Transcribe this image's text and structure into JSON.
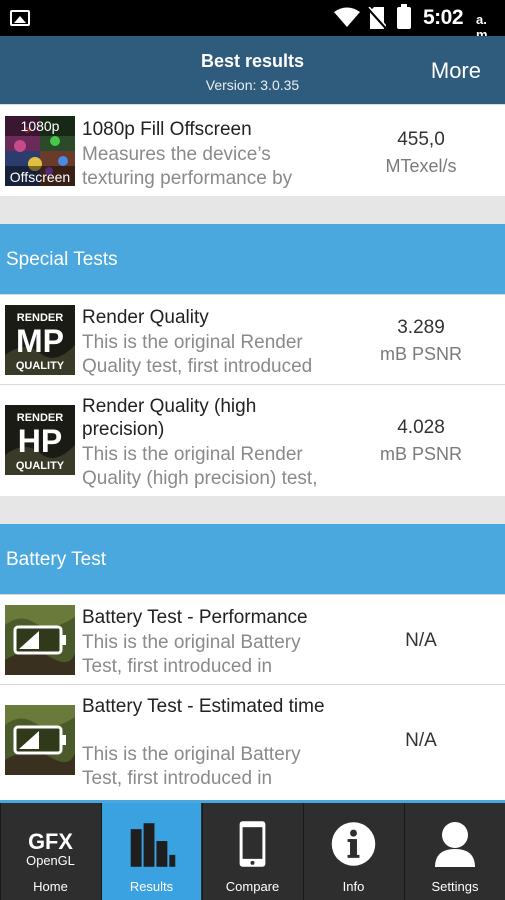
{
  "status_bar": {
    "time": "5:02",
    "ampm": "a. m."
  },
  "header": {
    "title": "Best results",
    "version": "Version: 3.0.35",
    "more_label": "More"
  },
  "rows_top": [
    {
      "icon": "fill-offscreen-thumbnail",
      "thumb_top": "1080p",
      "thumb_bottom": "Offscreen",
      "title": "1080p Fill Offscreen",
      "desc": "Measures the device’s texturing performance by",
      "value": "455,0",
      "unit": "MTexel/s"
    }
  ],
  "sections": [
    {
      "title": "Special Tests",
      "rows": [
        {
          "icon": "render-quality-mp-thumbnail",
          "badge_top": "RENDER",
          "badge_big": "MP",
          "badge_bottom": "QUALITY",
          "title": "Render Quality",
          "desc": "This is the original Render Quality test, first introduced",
          "value": "3.289",
          "unit": "mB PSNR"
        },
        {
          "icon": "render-quality-hp-thumbnail",
          "badge_top": "RENDER",
          "badge_big": "HP",
          "badge_bottom": "QUALITY",
          "title": "Render Quality (high precision)",
          "desc": "This is the original Render Quality (high precision) test,",
          "value": "4.028",
          "unit": "mB PSNR"
        }
      ]
    },
    {
      "title": "Battery Test",
      "rows": [
        {
          "icon": "battery-thumbnail",
          "title": "Battery Test - Performance",
          "desc": "This is the original Battery Test, first introduced in",
          "value": "N/A"
        },
        {
          "icon": "battery-thumbnail",
          "title": "Battery Test - Estimated time",
          "desc": "This is the original Battery Test, first introduced in",
          "value": "N/A"
        }
      ]
    }
  ],
  "tabs": [
    {
      "label": "Home",
      "icon": "gfx-opengl-logo",
      "logo_top": "GFX",
      "logo_bottom": "OpenGL"
    },
    {
      "label": "Results",
      "icon": "bar-chart-icon",
      "active": true
    },
    {
      "label": "Compare",
      "icon": "phone-icon"
    },
    {
      "label": "Info",
      "icon": "info-icon"
    },
    {
      "label": "Settings",
      "icon": "user-icon"
    }
  ],
  "colors": {
    "header": "#2f5c7c",
    "section": "#4aa8df",
    "tab_active": "#3aa2e0",
    "tab_bg": "#2e2e2e"
  }
}
